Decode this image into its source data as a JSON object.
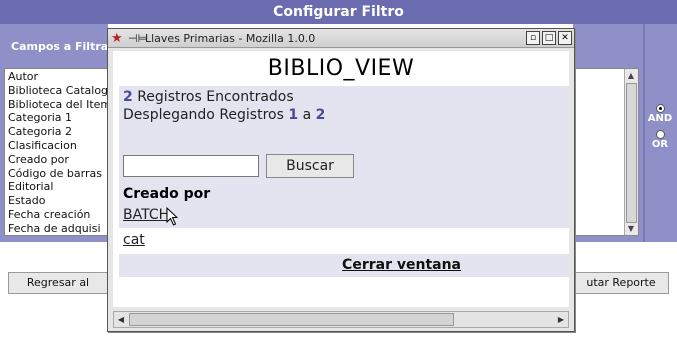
{
  "page": {
    "header_title": "Configurar Filtro",
    "fields_label": "Campos a Filtrar",
    "fields": [
      "Autor",
      "Biblioteca Catalog",
      "Biblioteca del Item",
      "Categoria 1",
      "Categoria 2",
      "Clasificacion",
      "Creado por",
      "Código de barras",
      "Editorial",
      "Estado",
      "Fecha creación",
      "Fecha de adquisi"
    ],
    "logic_options": [
      {
        "label": "AND",
        "selected": true
      },
      {
        "label": "OR",
        "selected": false
      }
    ],
    "back_button_label": "Regresar al",
    "run_report_button_label": "utar Reporte"
  },
  "popup": {
    "window_title": "Llaves Primarias - Mozilla 1.0.0",
    "app_title": "BIBLIO_VIEW",
    "found_count": "2",
    "found_text": "Registros Encontrados",
    "showing_prefix": "Desplegando Registros",
    "showing_from": "1",
    "showing_sep": "a",
    "showing_to": "2",
    "search_input_value": "",
    "search_button_label": "Buscar",
    "column_header": "Creado por",
    "records": [
      "BATCH",
      "cat"
    ],
    "close_link": "Cerrar ventana"
  }
}
